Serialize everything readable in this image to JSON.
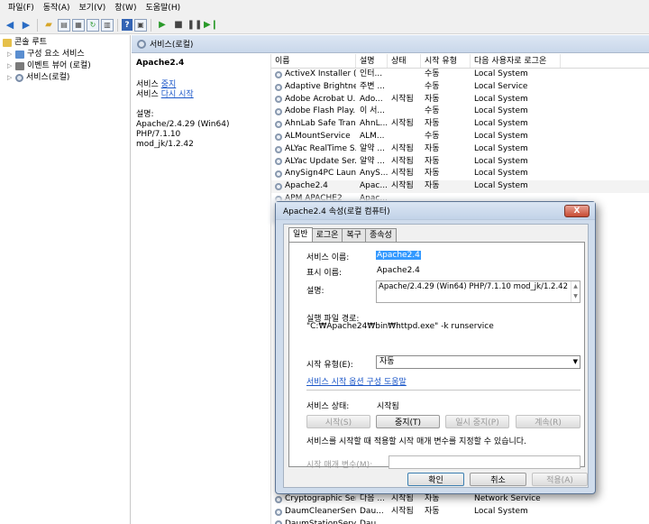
{
  "menu": [
    "파일(F)",
    "동작(A)",
    "보기(V)",
    "창(W)",
    "도움말(H)"
  ],
  "tree": [
    {
      "label": "콘솔 루트",
      "expander": ""
    },
    {
      "label": "구성 요소 서비스",
      "expander": "▷"
    },
    {
      "label": "이벤트 뷰어 (로컬)",
      "expander": "▷"
    },
    {
      "label": "서비스(로컬)",
      "expander": "▷"
    }
  ],
  "pane_title": "서비스(로컬)",
  "details": {
    "title": "Apache2.4",
    "line1_prefix": "서비스 ",
    "line1_link": "중지",
    "line2_prefix": "서비스 ",
    "line2_link": "다시 시작",
    "desc_label": "설명:",
    "desc_text1": "Apache/2.4.29 (Win64) PHP/7.1.10",
    "desc_text2": "mod_jk/1.2.42"
  },
  "columns": [
    "이름",
    "설명",
    "상태",
    "시작 유형",
    "다음 사용자로 로그온"
  ],
  "rows": [
    [
      "ActiveX Installer (...",
      "인터...",
      "",
      "수동",
      "Local System"
    ],
    [
      "Adaptive Brightness",
      "주변 ...",
      "",
      "수동",
      "Local Service"
    ],
    [
      "Adobe Acrobat U...",
      "Ado...",
      "시작됨",
      "자동",
      "Local System"
    ],
    [
      "Adobe Flash Play...",
      "이 서...",
      "",
      "수동",
      "Local System"
    ],
    [
      "AhnLab Safe Tran...",
      "AhnL...",
      "시작됨",
      "자동",
      "Local System"
    ],
    [
      "ALMountService",
      "ALM...",
      "",
      "수동",
      "Local System"
    ],
    [
      "ALYac RealTime S...",
      "알약 ...",
      "시작됨",
      "자동",
      "Local System"
    ],
    [
      "ALYac Update Ser...",
      "알약 ...",
      "시작됨",
      "자동",
      "Local System"
    ],
    [
      "AnySign4PC Laun...",
      "AnyS...",
      "시작됨",
      "자동",
      "Local System"
    ],
    [
      "Apache2.4",
      "Apac...",
      "시작됨",
      "자동",
      "Local System"
    ],
    [
      "APM APACHE2",
      "Apac...",
      "",
      "",
      ""
    ]
  ],
  "rows_bottom": [
    [
      "Cryptographic Ser...",
      "다음 ...",
      "시작됨",
      "자동",
      "Network Service"
    ],
    [
      "DaumCleanerServ...",
      "Dau...",
      "시작됨",
      "자동",
      "Local System"
    ],
    [
      "DaumStationServi...",
      "Dau...",
      "",
      "",
      ""
    ]
  ],
  "dialog": {
    "title": "Apache2.4 속성(로컬 컴퓨터)",
    "close": "X",
    "tabs": [
      "일반",
      "로그온",
      "복구",
      "종속성"
    ],
    "service_name_label": "서비스 이름:",
    "service_name": "Apache2.4",
    "display_name_label": "표시 이름:",
    "display_name": "Apache2.4",
    "desc_label": "설명:",
    "desc": "Apache/2.4.29 (Win64) PHP/7.1.10 mod_jk/1.2.42",
    "path_label": "실행 파일 경로:",
    "path": "\"C:₩Apache24₩bin₩httpd.exe\" -k runservice",
    "start_type_label": "시작 유형(E):",
    "start_type": "자동",
    "help_link": "서비스 시작 옵션 구성 도움말",
    "status_label": "서비스 상태:",
    "status": "시작됨",
    "btn_start": "시작(S)",
    "btn_stop": "중지(T)",
    "btn_pause": "일시 중지(P)",
    "btn_resume": "계속(R)",
    "hint": "서비스를 시작할 때 적용할 시작 매개 변수를 지정할 수 있습니다.",
    "param_label": "시작 매개 변수(M):",
    "ok": "확인",
    "cancel": "취소",
    "apply": "적용(A)"
  }
}
